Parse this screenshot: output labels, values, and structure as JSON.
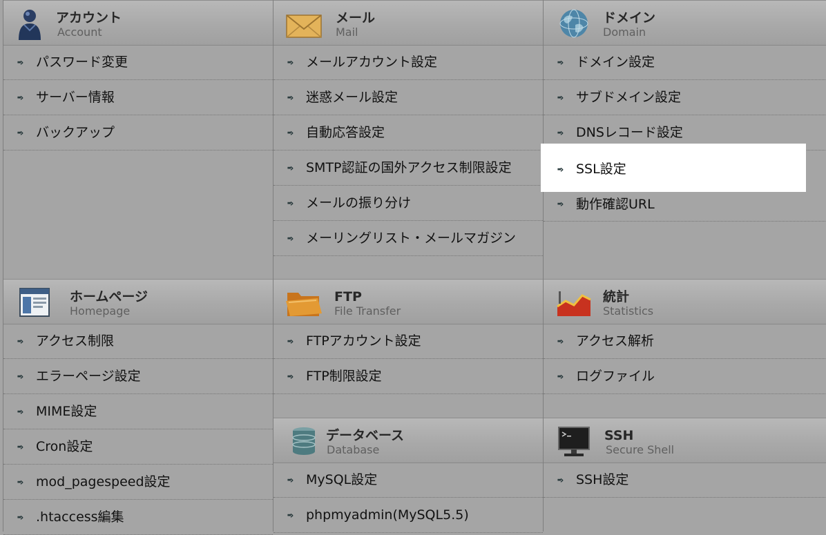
{
  "sections": {
    "account": {
      "title": "アカウント",
      "subtitle": "Account",
      "icon": "user-icon",
      "items": [
        "パスワード変更",
        "サーバー情報",
        "バックアップ"
      ]
    },
    "mail": {
      "title": "メール",
      "subtitle": "Mail",
      "icon": "envelope-icon",
      "items": [
        "メールアカウント設定",
        "迷惑メール設定",
        "自動応答設定",
        "SMTP認証の国外アクセス制限設定",
        "メールの振り分け",
        "メーリングリスト・メールマガジン"
      ]
    },
    "domain": {
      "title": "ドメイン",
      "subtitle": "Domain",
      "icon": "globe-icon",
      "items": [
        "ドメイン設定",
        "サブドメイン設定",
        "DNSレコード設定",
        "SSL設定",
        "動作確認URL"
      ]
    },
    "homepage": {
      "title": "ホームページ",
      "subtitle": "Homepage",
      "icon": "browser-window-icon",
      "items": [
        "アクセス制限",
        "エラーページ設定",
        "MIME設定",
        "Cron設定",
        "mod_pagespeed設定",
        ".htaccess編集"
      ]
    },
    "ftp": {
      "title": "FTP",
      "subtitle": "File Transfer",
      "icon": "folder-icon",
      "items": [
        "FTPアカウント設定",
        "FTP制限設定"
      ]
    },
    "stats": {
      "title": "統計",
      "subtitle": "Statistics",
      "icon": "bar-chart-icon",
      "items": [
        "アクセス解析",
        "ログファイル"
      ]
    },
    "database": {
      "title": "データベース",
      "subtitle": "Database",
      "icon": "database-icon",
      "items": [
        "MySQL設定",
        "phpmyadmin(MySQL5.5)"
      ]
    },
    "ssh": {
      "title": "SSH",
      "subtitle": "Secure Shell",
      "icon": "terminal-icon",
      "items": [
        "SSH設定"
      ]
    }
  },
  "highlighted_item": "SSL設定",
  "colors": {
    "page_bg": "#a5a5a5",
    "highlight": "#ffffff",
    "arrow": "#28393c"
  }
}
